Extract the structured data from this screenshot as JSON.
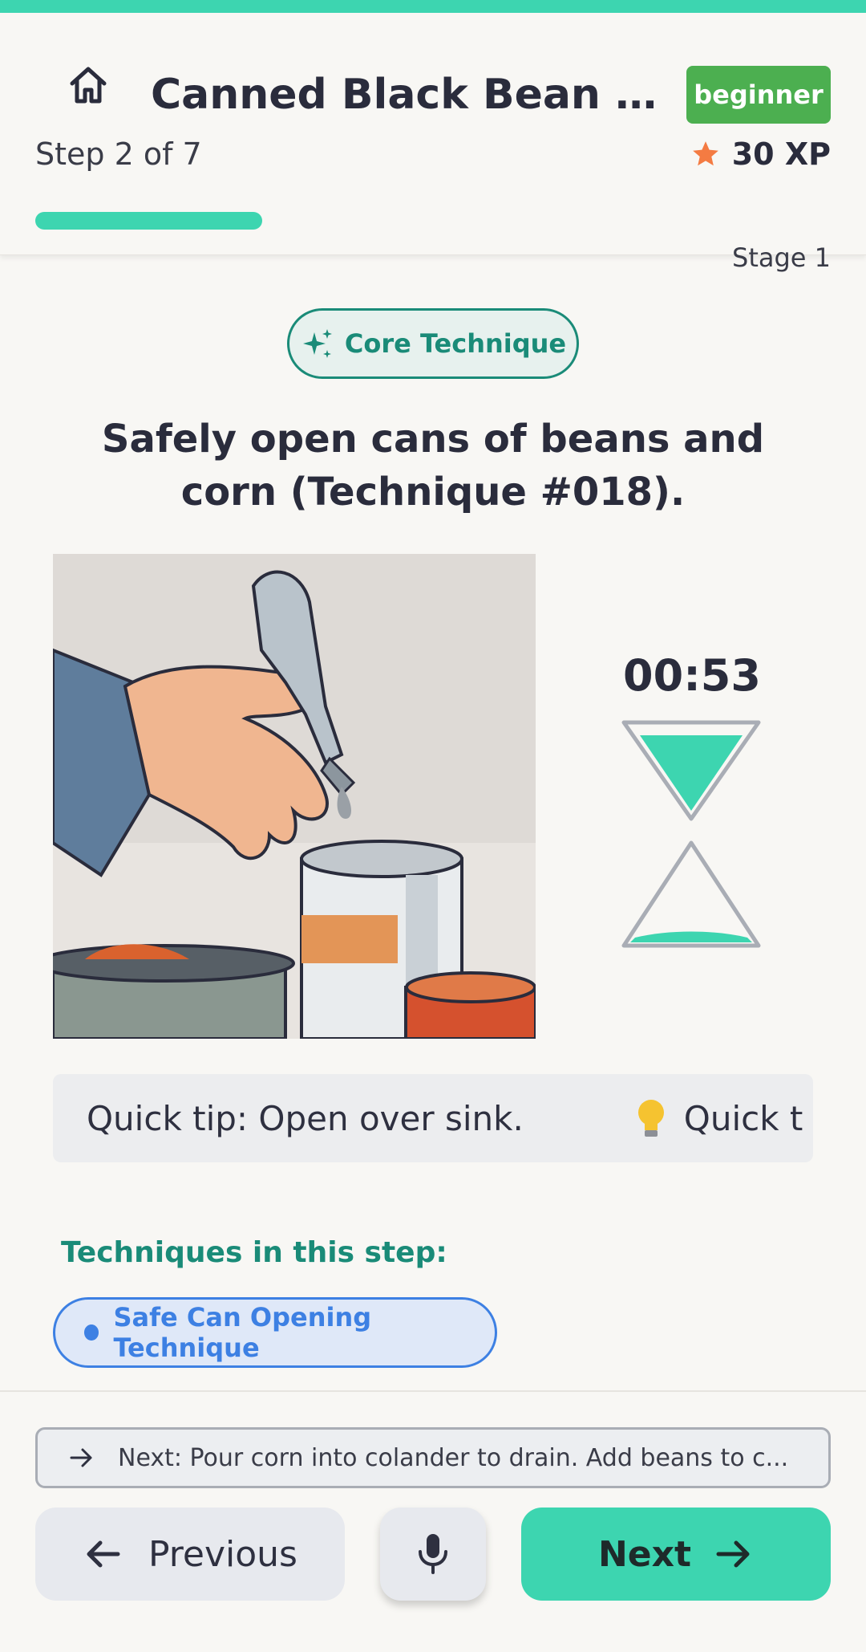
{
  "header": {
    "title": "Canned Black Bean Sala...",
    "difficulty": "beginner",
    "step_label": "Step 2 of 7",
    "xp": "30 XP",
    "stage": "Stage 1",
    "progress_fraction": 0.2857
  },
  "step": {
    "category": "Core Technique",
    "instruction": "Safely open cans of beans and corn (Technique #018).",
    "timer": "00:53",
    "tip_text": "Quick tip: Open over sink.",
    "tip_ticker_repeat": "Quick t",
    "techniques_heading": "Techniques in this step:",
    "techniques": [
      "Safe Can Opening Technique"
    ]
  },
  "footer": {
    "next_preview": "Next: Pour corn into colander to drain. Add beans to c...",
    "previous_label": "Previous",
    "next_label": "Next"
  },
  "icons": {
    "home": "home-icon",
    "star": "star-icon",
    "sparkle": "sparkle-icon",
    "bulb": "lightbulb-icon",
    "arrow_right": "arrow-right-icon",
    "arrow_left": "arrow-left-icon",
    "mic": "microphone-icon"
  },
  "colors": {
    "accent": "#3dd5b0",
    "beginner_badge": "#4caf50",
    "technique_green": "#1a8b78",
    "technique_blue": "#3d80e3",
    "star": "#f47b42"
  }
}
